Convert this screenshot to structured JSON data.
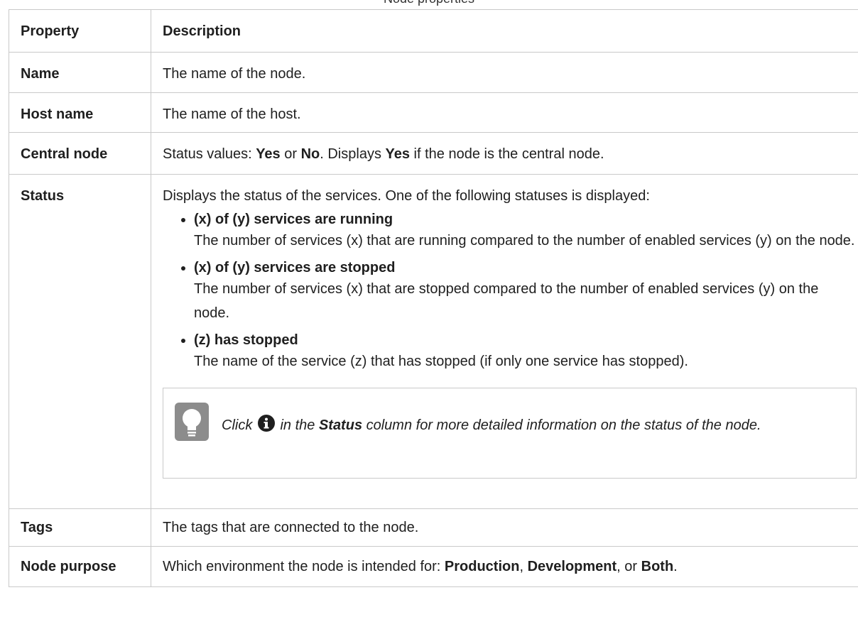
{
  "caption": "Node properties",
  "headers": {
    "property": "Property",
    "description": "Description"
  },
  "rows": {
    "name": {
      "property": "Name",
      "description": "The name of the node."
    },
    "host": {
      "property": "Host name",
      "description": "The name of the host."
    },
    "central": {
      "property": "Central node",
      "desc_prefix": "Status values: ",
      "yes": "Yes",
      "or": " or ",
      "no": "No",
      "desc_mid": ". Displays ",
      "yes2": "Yes",
      "desc_suffix": " if the node is the central node."
    },
    "status": {
      "property": "Status",
      "intro": "Displays the status of the services. One of the following statuses is displayed:",
      "items": [
        {
          "title": "(x) of (y) services are running",
          "text": "The number of services (x) that are running compared to the number of enabled services (y) on the node."
        },
        {
          "title": "(x) of (y) services are stopped",
          "text": "The number of services (x) that are stopped compared to the number of enabled services (y) on the node."
        },
        {
          "title": "(z) has stopped",
          "text": "The name of the service (z) that has stopped (if only one service has stopped)."
        }
      ],
      "tip": {
        "icon": "lightbulb-icon",
        "click": "Click ",
        "info_icon": "info-circle-icon",
        "in_the": " in the ",
        "status_word": "Status",
        "rest": " column for more detailed information on the status of the node."
      }
    },
    "tags": {
      "property": "Tags",
      "description": "The tags that are connected to the node."
    },
    "purpose": {
      "property": "Node purpose",
      "desc_prefix": "Which environment the node is intended for: ",
      "production": "Production",
      "sep1": ", ",
      "development": "Development",
      "sep2": ", or ",
      "both": "Both",
      "desc_suffix": "."
    }
  },
  "colors": {
    "border": "#c9c9c9",
    "tip_icon_bg": "#8c8c8c",
    "text": "#1f1f1f"
  }
}
